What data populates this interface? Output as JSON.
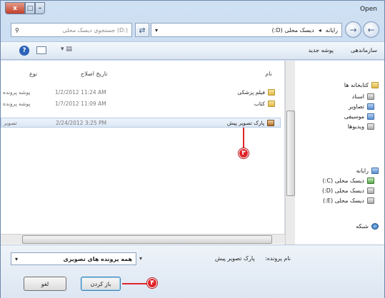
{
  "window": {
    "title": "Open"
  },
  "title_buttons": {
    "close": "x",
    "maximize": "□",
    "minimize": "–"
  },
  "address": {
    "search_placeholder": "جستجوی دیسک محلی (D:)",
    "crumbs": [
      "رایانه",
      "دیسک محلی (D:)"
    ],
    "dropdown_glyph": "▾"
  },
  "toolbar": {
    "organize": "سازماندهی",
    "new_folder": "پوشه جدید"
  },
  "columns": {
    "name": "نام",
    "date": "تاریخ اصلاح",
    "type": "نوع"
  },
  "files": [
    {
      "name": "فیلم پزشکی",
      "date": "1/2/2012 11:24 AM",
      "type": "پوشه پرونده"
    },
    {
      "name": "کتاب",
      "date": "1/7/2012 11:09 AM",
      "type": "پوشه پرونده"
    },
    {
      "name": "پارک تصویر پیش",
      "date": "2/24/2012 3:25 PM",
      "type": "تصویر"
    }
  ],
  "nav": {
    "favorites": "کتابخانه ها",
    "items": [
      "اسناد",
      "تصاویر",
      "موسیقی",
      "ویدیوها"
    ],
    "computer": "رایانه",
    "drives": [
      "دیسک محلی (C:)",
      "دیسک محلی (D:)",
      "دیسک محلی (E:)"
    ],
    "network": "شبکه"
  },
  "bottom": {
    "filename_label": "نام پرونده:",
    "filename_value": "پارک تصویر پیش",
    "filetype_value": "همه پرونده های تصویری",
    "open_label": "باز کردن",
    "cancel_label": "لغو"
  },
  "markers": [
    "۳",
    "۴"
  ],
  "colors": {
    "marker": "#e0242a",
    "window_bg": "#cfe0f3",
    "selection": "#dbe7f5"
  }
}
